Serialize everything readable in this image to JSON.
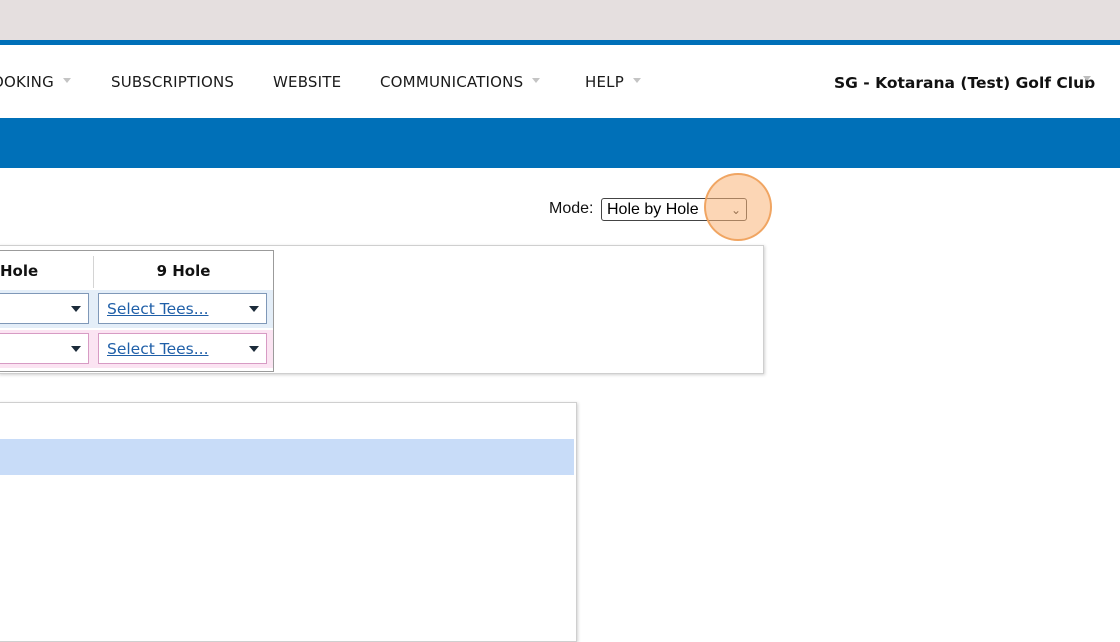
{
  "nav": {
    "items": [
      {
        "label": "OOKING",
        "has_dropdown": true
      },
      {
        "label": "SUBSCRIPTIONS",
        "has_dropdown": false
      },
      {
        "label": "WEBSITE",
        "has_dropdown": false
      },
      {
        "label": "COMMUNICATIONS",
        "has_dropdown": true
      },
      {
        "label": "HELP",
        "has_dropdown": true
      }
    ],
    "club_name": "SG - Kotarana (Test) Golf Club"
  },
  "mode": {
    "label": "Mode:",
    "selected": "Hole by Hole"
  },
  "tees_table": {
    "columns": [
      "Hole",
      "9 Hole"
    ],
    "rows": [
      {
        "cells": [
          "",
          "Select Tees..."
        ]
      },
      {
        "cells": [
          "",
          "Select Tees..."
        ]
      }
    ]
  },
  "colors": {
    "brand_blue": "#0070b8",
    "row1_bg": "#e4eef8",
    "row2_bg": "#fbe4f2",
    "row1_border": "#7f98b8",
    "row2_border": "#d79bc4",
    "selected_row": "#c8dcf8",
    "click_highlight": "#f5b47a"
  }
}
